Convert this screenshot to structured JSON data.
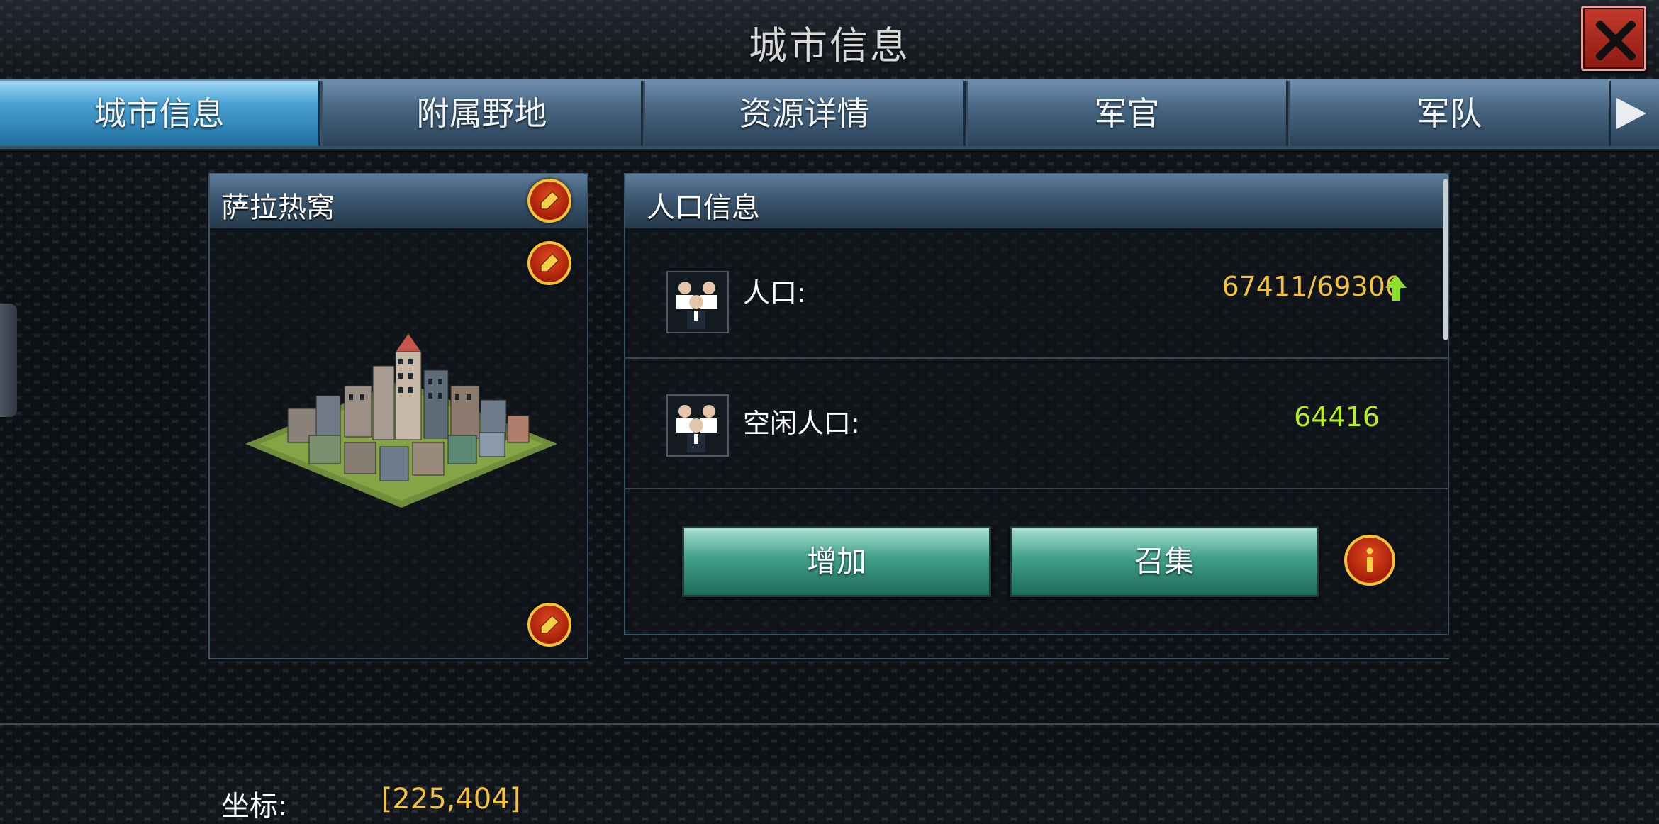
{
  "window": {
    "title": "城市信息",
    "close_icon": "close-x-icon"
  },
  "tabs": [
    {
      "label": "城市信息",
      "active": true
    },
    {
      "label": "附属野地",
      "active": false
    },
    {
      "label": "资源详情",
      "active": false
    },
    {
      "label": "军官",
      "active": false
    },
    {
      "label": "军队",
      "active": false
    }
  ],
  "city": {
    "name": "萨拉热窝",
    "coord_label": "坐标:",
    "coord_value": "[225,404]"
  },
  "population": {
    "title": "人口信息",
    "rows": [
      {
        "label": "人口:",
        "value": "67411/69300",
        "trend_icon": "arrow-up-icon"
      },
      {
        "label": "空闲人口:",
        "value": "64416"
      }
    ],
    "buttons": {
      "increase": "增加",
      "gather": "召集"
    }
  },
  "colors": {
    "accent_gold": "#f4c33a",
    "accent_green": "#b7ef1c",
    "tab_active": "#4aa2d4",
    "button_teal": "#3f9f88",
    "close_red": "#c53a2c"
  }
}
